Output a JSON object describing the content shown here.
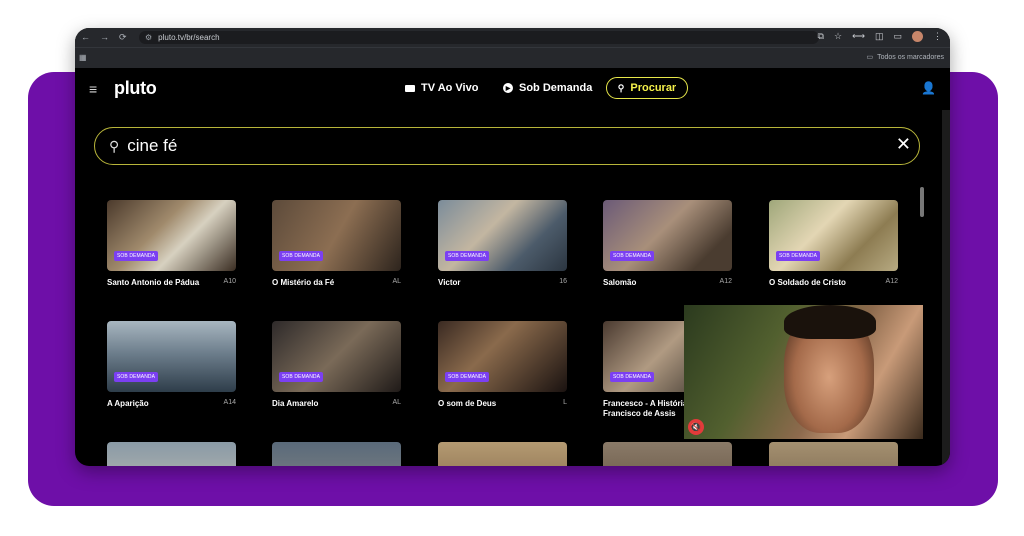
{
  "browser": {
    "nav_back": "←",
    "nav_forward": "→",
    "nav_reload": "⟳",
    "url": "pluto.tv/br/search",
    "bookmarks_label": "Todos os marcadores"
  },
  "header": {
    "logo": "pluto",
    "nav": [
      {
        "label": "TV Ao Vivo"
      },
      {
        "label": "Sob Demanda"
      }
    ],
    "search_button": "Procurar"
  },
  "search": {
    "query": "cine fé"
  },
  "badge_label": "SOB DEMANDA",
  "results": [
    {
      "title": "Santo Antonio de Pádua",
      "rating": "A10"
    },
    {
      "title": "O Mistério da Fé",
      "rating": "AL"
    },
    {
      "title": "Victor",
      "rating": "16"
    },
    {
      "title": "Salomão",
      "rating": "A12"
    },
    {
      "title": "O Soldado de Cristo",
      "rating": "A12"
    },
    {
      "title": "A Aparição",
      "rating": "A14"
    },
    {
      "title": "Dia Amarelo",
      "rating": "AL"
    },
    {
      "title": "O som de Deus",
      "rating": "L"
    },
    {
      "title": "Francesco - A História de São Francisco de Assis",
      "rating": ""
    }
  ],
  "icons": {
    "menu": "hamburger-icon",
    "user": "user-icon",
    "search": "search-icon",
    "clear": "close-icon",
    "mute": "mute-icon"
  },
  "colors": {
    "accent_yellow": "#f4f04a",
    "badge_purple": "#7b3ff2",
    "frame_purple": "#6e0fa8",
    "mute_red": "#e23b3b"
  }
}
